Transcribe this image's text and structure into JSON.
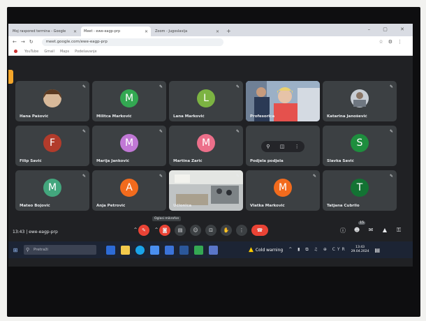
{
  "browser": {
    "tabs": [
      {
        "title": "Moj raspored termina - Google",
        "active": false
      },
      {
        "title": "Meet - ewe-eagp-prp",
        "active": true
      },
      {
        "title": "Zoom - Jugoslavija",
        "active": false
      }
    ],
    "url": "meet.google.com/ewe-eagp-prp",
    "window_controls": "–  ▢  ✕",
    "bookmarks": [
      "YouTube",
      "Gmail",
      "Maps",
      "Podešavanje"
    ]
  },
  "participants": [
    {
      "name": "Hana Pašović",
      "initial": "",
      "color": "#5f6368",
      "kind": "photo"
    },
    {
      "name": "Militca Marković",
      "initial": "M",
      "color": "#33a852"
    },
    {
      "name": "Lana Marković",
      "initial": "L",
      "color": "#7cb342"
    },
    {
      "name": "Profesorica",
      "initial": "",
      "color": "#9aa0a6",
      "kind": "video"
    },
    {
      "name": "Katarina Janošević",
      "initial": "",
      "color": "#5f6368",
      "kind": "photo"
    },
    {
      "name": "Filip Savić",
      "initial": "F",
      "color": "#b23b2b"
    },
    {
      "name": "Marija Janković",
      "initial": "M",
      "color": "#c178d6"
    },
    {
      "name": "Martina Zarić",
      "initial": "M",
      "color": "#ec6f8a"
    },
    {
      "name": "Podjela podjela",
      "initial": "",
      "color": "#3c4043",
      "kind": "pinned"
    },
    {
      "name": "Slavka Savić",
      "initial": "S",
      "color": "#1e8e3e"
    },
    {
      "name": "Mateo Bojović",
      "initial": "M",
      "color": "#43a67d"
    },
    {
      "name": "Anja Petrović",
      "initial": "A",
      "color": "#f26b1d"
    },
    {
      "name": "Učionica",
      "initial": "",
      "color": "#8b8f92",
      "kind": "room"
    },
    {
      "name": "Vlatka Marković",
      "initial": "M",
      "color": "#f26b1d"
    },
    {
      "name": "Tatjana Čubrilo",
      "initial": "T",
      "color": "#137333"
    }
  ],
  "meeting": {
    "time": "13:43",
    "code": "ewe-eagp-prp",
    "tooltip": "Oglasi mikrofon",
    "people_badge": "15"
  },
  "taskbar": {
    "search_placeholder": "Pretraži",
    "weather": "Cold warning",
    "time": "13:43",
    "date": "29.04.2024",
    "tray": "^ ▮ ⧉ ♫ ⊕ CYR"
  }
}
